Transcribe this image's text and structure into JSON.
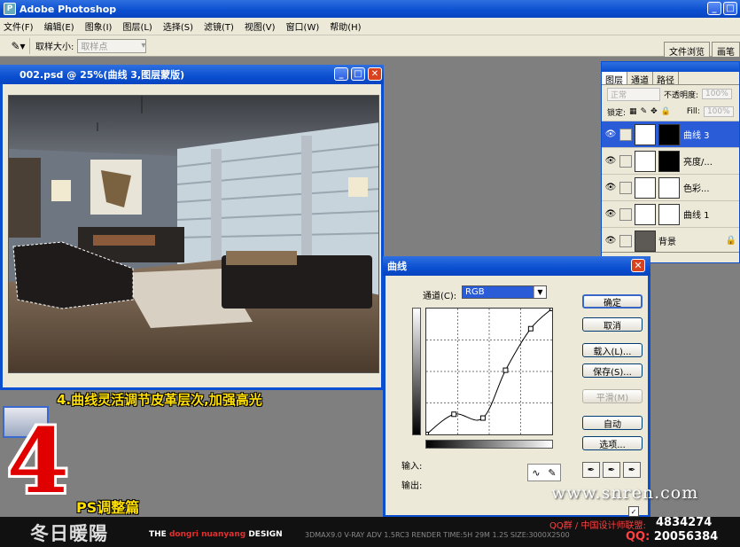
{
  "app": {
    "title": "Adobe Photoshop"
  },
  "menu": [
    "文件(F)",
    "编辑(E)",
    "图象(I)",
    "图层(L)",
    "选择(S)",
    "滤镜(T)",
    "视图(V)",
    "窗口(W)",
    "帮助(H)"
  ],
  "options": {
    "sample_size_label": "取样大小:",
    "sample_size_value": "取样点"
  },
  "palette_well": [
    "文件浏览",
    "画笔"
  ],
  "document": {
    "title": "002.psd @ 25%(曲线 3,图层蒙版)"
  },
  "caption": "4.曲线灵活调节皮革层次,加强高光",
  "chapter": {
    "number": "4",
    "label": "PS调整篇"
  },
  "layers_panel": {
    "tabs": [
      "图层",
      "通道",
      "路径"
    ],
    "blend_mode": "正常",
    "opacity_label": "不透明度:",
    "opacity_value": "100%",
    "lock_label": "锁定:",
    "fill_label": "Fill:",
    "fill_value": "100%",
    "layers": [
      {
        "name": "曲线 3",
        "active": true,
        "mask": "dark"
      },
      {
        "name": "亮度/...",
        "active": false,
        "mask": "dark"
      },
      {
        "name": "色彩...",
        "active": false,
        "mask": "white"
      },
      {
        "name": "曲线 1",
        "active": false,
        "mask": "white"
      },
      {
        "name": "背景",
        "active": false,
        "mask": "none"
      }
    ]
  },
  "curves_dialog": {
    "title": "曲线",
    "channel_label": "通道(C):",
    "channel_value": "RGB",
    "input_label": "输入:",
    "output_label": "输出:",
    "buttons": {
      "ok": "确定",
      "cancel": "取消",
      "load": "载入(L)...",
      "save": "保存(S)...",
      "smooth": "平滑(M)",
      "auto": "自动",
      "options": "选项..."
    },
    "curve_points_normalized": [
      [
        0,
        0
      ],
      [
        0.22,
        0.16
      ],
      [
        0.45,
        0.13
      ],
      [
        0.63,
        0.51
      ],
      [
        0.83,
        0.84
      ],
      [
        1,
        1
      ]
    ]
  },
  "banner": {
    "brand": "冬日暖陽",
    "design_prefix": "THE",
    "design_name": "dongri nuanyang",
    "design_suffix": "DESIGN",
    "specs": "3DMAX9.0  V-RAY ADV 1.5RC3   RENDER TIME:5H 29M 1.2S  SIZE:3000X2500",
    "group_label": "QQ群 / 中国设计师联盟:",
    "group_number": "4834274",
    "qq_label": "QQ:",
    "qq_number": "20056384"
  },
  "watermark": "www.snren.com"
}
